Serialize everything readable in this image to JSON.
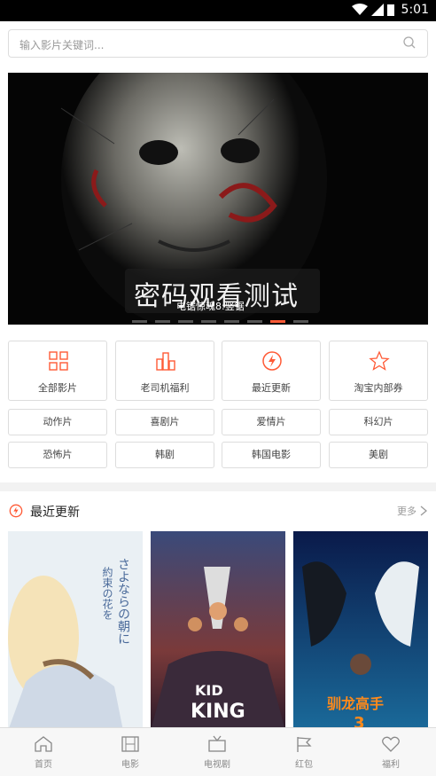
{
  "status": {
    "time": "5:01"
  },
  "search": {
    "placeholder": "输入影片关键词..."
  },
  "banner": {
    "title": "密码观看测试",
    "subtitle": "电锯惊魂8:竖锯",
    "slide_count": 8,
    "active_slide": 7
  },
  "categories": [
    {
      "label": "全部影片",
      "icon": "grid-icon"
    },
    {
      "label": "老司机福利",
      "icon": "chart-icon"
    },
    {
      "label": "最近更新",
      "icon": "refresh-icon"
    },
    {
      "label": "淘宝内部券",
      "icon": "star-icon"
    }
  ],
  "genres": [
    "动作片",
    "喜剧片",
    "爱情片",
    "科幻片",
    "恐怖片",
    "韩剧",
    "韩国电影",
    "美剧"
  ],
  "recent": {
    "title": "最近更新",
    "more": "更多"
  },
  "posters": [
    {
      "name": "さよならの朝に約束の花をかざろう"
    },
    {
      "name": "The Kid Who Would Be King"
    },
    {
      "name": "驯龙高手3"
    }
  ],
  "tabs": [
    {
      "label": "首页",
      "icon": "home-icon"
    },
    {
      "label": "电影",
      "icon": "film-icon"
    },
    {
      "label": "电视剧",
      "icon": "tv-icon"
    },
    {
      "label": "红包",
      "icon": "flag-icon"
    },
    {
      "label": "福利",
      "icon": "heart-icon"
    }
  ],
  "colors": {
    "accent": "#ff5a36",
    "border": "#dddddd"
  }
}
